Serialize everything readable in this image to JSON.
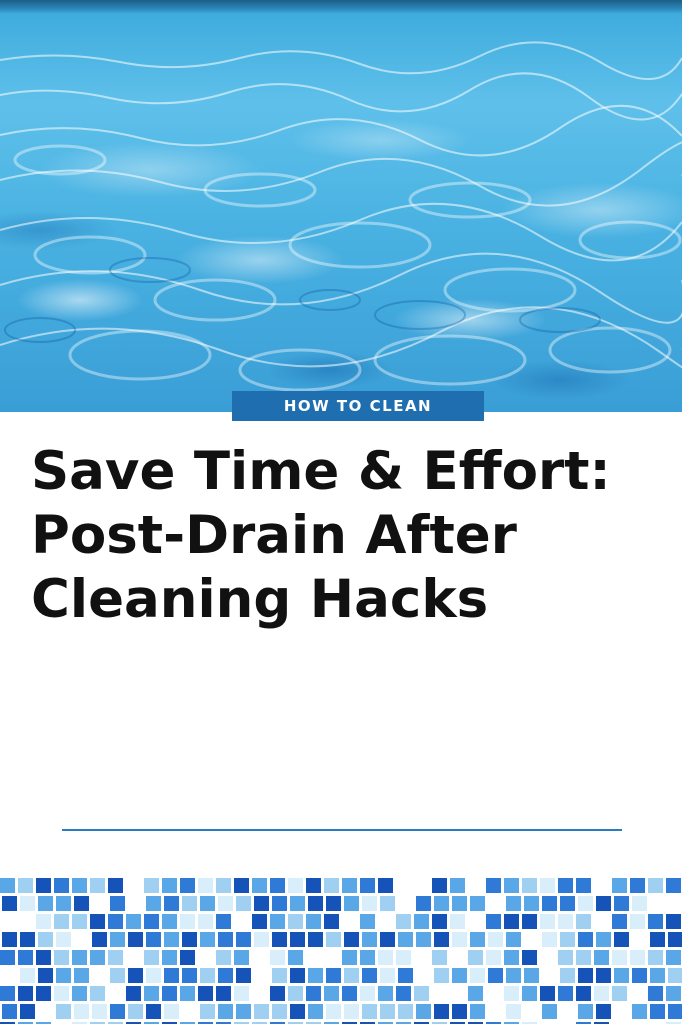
{
  "badge": {
    "label": "HOW TO CLEAN"
  },
  "headline": {
    "lines": [
      "Save Time & Effort:",
      "Post-Drain After",
      "Cleaning Hacks"
    ]
  },
  "colors": {
    "badge_background": "#1f6fb0",
    "divider": "#2a7bbf",
    "headline_text": "#111111",
    "water": "#49b2e2",
    "tile_palette": [
      "#1553b8",
      "#2f7ad6",
      "#5aa7e8",
      "#9fd0f2",
      "#d9eefb",
      "#ffffff"
    ]
  }
}
